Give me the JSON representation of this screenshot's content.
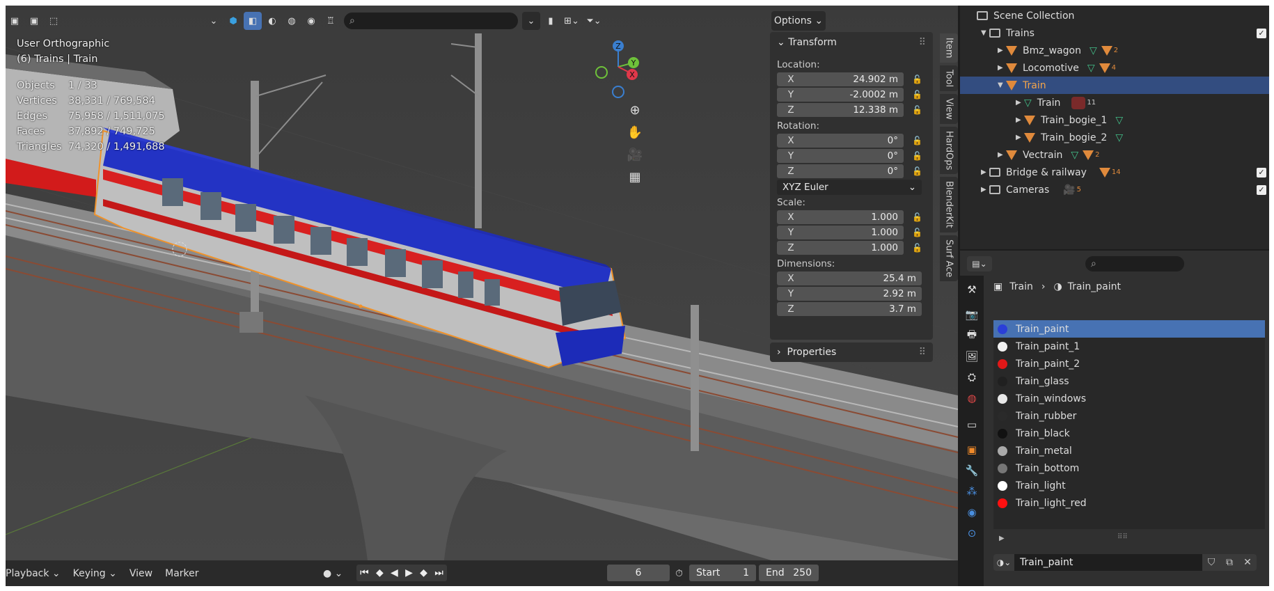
{
  "viewport": {
    "view_name": "User Orthographic",
    "context": "(6) Trains | Train",
    "stats": [
      {
        "label": "Objects",
        "value": "1 / 33"
      },
      {
        "label": "Vertices",
        "value": "38,331 / 769,584"
      },
      {
        "label": "Edges",
        "value": "75,958 / 1,511,075"
      },
      {
        "label": "Faces",
        "value": "37,892 / 749,725"
      },
      {
        "label": "Triangles",
        "value": "74,320 / 1,491,688"
      }
    ],
    "options_label": "Options",
    "gizmo": {
      "z": "Z",
      "y": "Y",
      "x": "X"
    }
  },
  "npanel": {
    "transform_label": "Transform",
    "location_label": "Location:",
    "location": {
      "x": "24.902 m",
      "y": "-2.0002 m",
      "z": "12.338 m"
    },
    "rotation_label": "Rotation:",
    "rotation": {
      "x": "0°",
      "y": "0°",
      "z": "0°"
    },
    "rotation_mode": "XYZ Euler",
    "scale_label": "Scale:",
    "scale": {
      "x": "1.000",
      "y": "1.000",
      "z": "1.000"
    },
    "dimensions_label": "Dimensions:",
    "dimensions": {
      "x": "25.4 m",
      "y": "2.92 m",
      "z": "3.7 m"
    },
    "properties_label": "Properties",
    "axis": {
      "x": "X",
      "y": "Y",
      "z": "Z"
    },
    "tabs": [
      "Item",
      "Tool",
      "View",
      "HardOps",
      "BlenderKit",
      "Surf Ace"
    ]
  },
  "timeline": {
    "playback": "Playback",
    "keying": "Keying",
    "view": "View",
    "marker": "Marker",
    "current_frame": "6",
    "start_label": "Start",
    "start": "1",
    "end_label": "End",
    "end": "250"
  },
  "outliner": {
    "scene_collection": "Scene Collection",
    "trains": "Trains",
    "bmz_wagon": "Bmz_wagon",
    "bmz_badge": "2",
    "locomotive": "Locomotive",
    "loco_badge": "4",
    "train": "Train",
    "train_mesh": "Train",
    "train_mesh_badge": "11",
    "bogie1": "Train_bogie_1",
    "bogie2": "Train_bogie_2",
    "vectrain": "Vectrain",
    "vectrain_badge": "2",
    "bridge": "Bridge & railway",
    "bridge_badge": "14",
    "cameras": "Cameras",
    "cameras_badge": "5"
  },
  "properties": {
    "breadcrumb_object": "Train",
    "breadcrumb_material": "Train_paint",
    "materials": [
      {
        "name": "Train_paint",
        "color": "#2a3fd8"
      },
      {
        "name": "Train_paint_1",
        "color": "#f2f2f2"
      },
      {
        "name": "Train_paint_2",
        "color": "#e01818"
      },
      {
        "name": "Train_glass",
        "color": "#202020"
      },
      {
        "name": "Train_windows",
        "color": "#e8e8e8"
      },
      {
        "name": "Train_rubber",
        "color": "#2a2a2a"
      },
      {
        "name": "Train_black",
        "color": "#111111"
      },
      {
        "name": "Train_metal",
        "color": "#aaaaaa"
      },
      {
        "name": "Train_bottom",
        "color": "#777777"
      },
      {
        "name": "Train_light",
        "color": "#ffffff"
      },
      {
        "name": "Train_light_red",
        "color": "#ff1010"
      }
    ],
    "active_material": "Train_paint"
  }
}
